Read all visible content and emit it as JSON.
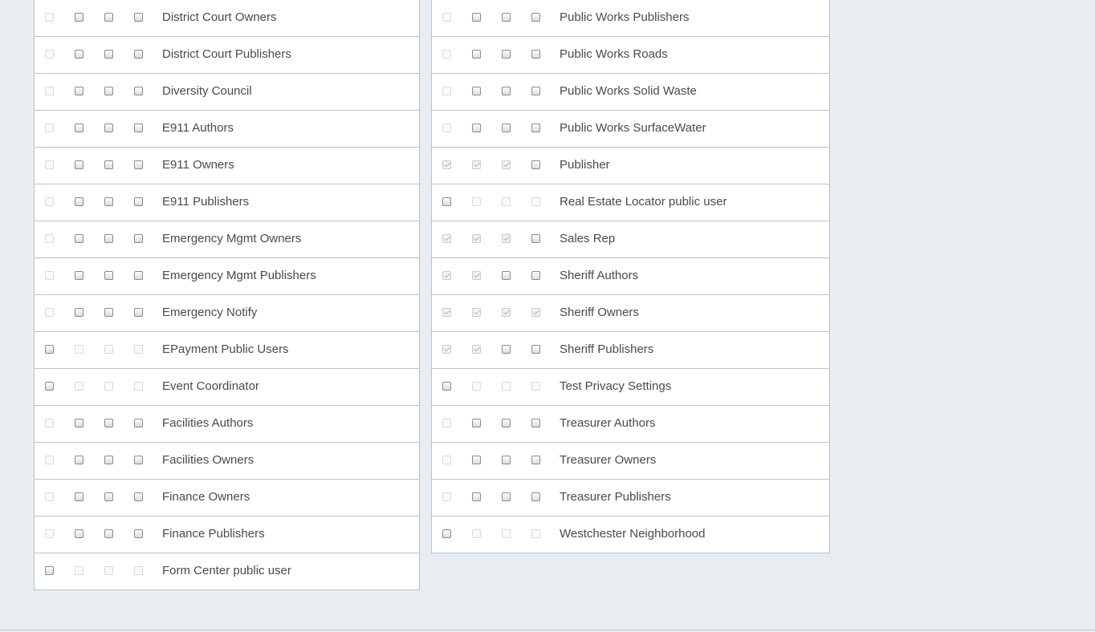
{
  "left_rows": [
    {
      "label": "District Court Owners",
      "checks": [
        "disabled",
        "unchecked",
        "unchecked",
        "unchecked"
      ]
    },
    {
      "label": "District Court Publishers",
      "checks": [
        "disabled",
        "unchecked",
        "unchecked",
        "unchecked"
      ]
    },
    {
      "label": "Diversity Council",
      "checks": [
        "disabled",
        "unchecked",
        "unchecked",
        "unchecked"
      ]
    },
    {
      "label": "E911 Authors",
      "checks": [
        "disabled",
        "unchecked",
        "unchecked",
        "unchecked"
      ]
    },
    {
      "label": "E911 Owners",
      "checks": [
        "disabled",
        "unchecked",
        "unchecked",
        "unchecked"
      ]
    },
    {
      "label": "E911 Publishers",
      "checks": [
        "disabled",
        "unchecked",
        "unchecked",
        "unchecked"
      ]
    },
    {
      "label": "Emergency Mgmt Owners",
      "checks": [
        "disabled",
        "unchecked",
        "unchecked",
        "unchecked"
      ]
    },
    {
      "label": "Emergency Mgmt Publishers",
      "checks": [
        "disabled",
        "unchecked",
        "unchecked",
        "unchecked"
      ]
    },
    {
      "label": "Emergency Notify",
      "checks": [
        "disabled",
        "unchecked",
        "unchecked",
        "unchecked"
      ]
    },
    {
      "label": "EPayment Public Users",
      "checks": [
        "unchecked",
        "disabled",
        "disabled",
        "disabled"
      ]
    },
    {
      "label": "Event Coordinator",
      "checks": [
        "unchecked",
        "disabled",
        "disabled",
        "disabled"
      ]
    },
    {
      "label": "Facilities Authors",
      "checks": [
        "disabled",
        "unchecked",
        "unchecked",
        "unchecked"
      ]
    },
    {
      "label": "Facilities Owners",
      "checks": [
        "disabled",
        "unchecked",
        "unchecked",
        "unchecked"
      ]
    },
    {
      "label": "Finance Owners",
      "checks": [
        "disabled",
        "unchecked",
        "unchecked",
        "unchecked"
      ]
    },
    {
      "label": "Finance Publishers",
      "checks": [
        "disabled",
        "unchecked",
        "unchecked",
        "unchecked"
      ]
    },
    {
      "label": "Form Center public user",
      "checks": [
        "unchecked",
        "disabled",
        "disabled",
        "disabled"
      ]
    }
  ],
  "right_rows": [
    {
      "label": "Public Works Publishers",
      "checks": [
        "disabled",
        "unchecked",
        "unchecked",
        "unchecked"
      ]
    },
    {
      "label": "Public Works Roads",
      "checks": [
        "disabled",
        "unchecked",
        "unchecked",
        "unchecked"
      ]
    },
    {
      "label": "Public Works Solid Waste",
      "checks": [
        "disabled",
        "unchecked",
        "unchecked",
        "unchecked"
      ]
    },
    {
      "label": "Public Works SurfaceWater",
      "checks": [
        "disabled",
        "unchecked",
        "unchecked",
        "unchecked"
      ]
    },
    {
      "label": "Publisher",
      "checks": [
        "checked",
        "checked",
        "checked",
        "unchecked"
      ]
    },
    {
      "label": "Real Estate Locator public user",
      "checks": [
        "unchecked",
        "disabled",
        "disabled",
        "disabled"
      ]
    },
    {
      "label": "Sales Rep",
      "checks": [
        "checked",
        "checked",
        "checked",
        "unchecked"
      ]
    },
    {
      "label": "Sheriff Authors",
      "checks": [
        "checked",
        "checked",
        "unchecked",
        "unchecked"
      ]
    },
    {
      "label": "Sheriff Owners",
      "checks": [
        "checked",
        "checked",
        "checked",
        "checked"
      ]
    },
    {
      "label": "Sheriff Publishers",
      "checks": [
        "checked",
        "checked",
        "unchecked",
        "unchecked"
      ]
    },
    {
      "label": "Test Privacy Settings",
      "checks": [
        "unchecked",
        "disabled",
        "disabled",
        "disabled"
      ]
    },
    {
      "label": "Treasurer Authors",
      "checks": [
        "disabled",
        "unchecked",
        "unchecked",
        "unchecked"
      ]
    },
    {
      "label": "Treasurer Owners",
      "checks": [
        "disabled",
        "unchecked",
        "unchecked",
        "unchecked"
      ]
    },
    {
      "label": "Treasurer Publishers",
      "checks": [
        "disabled",
        "unchecked",
        "unchecked",
        "unchecked"
      ]
    },
    {
      "label": "Westchester Neighborhood",
      "checks": [
        "unchecked",
        "disabled",
        "disabled",
        "disabled"
      ]
    }
  ]
}
